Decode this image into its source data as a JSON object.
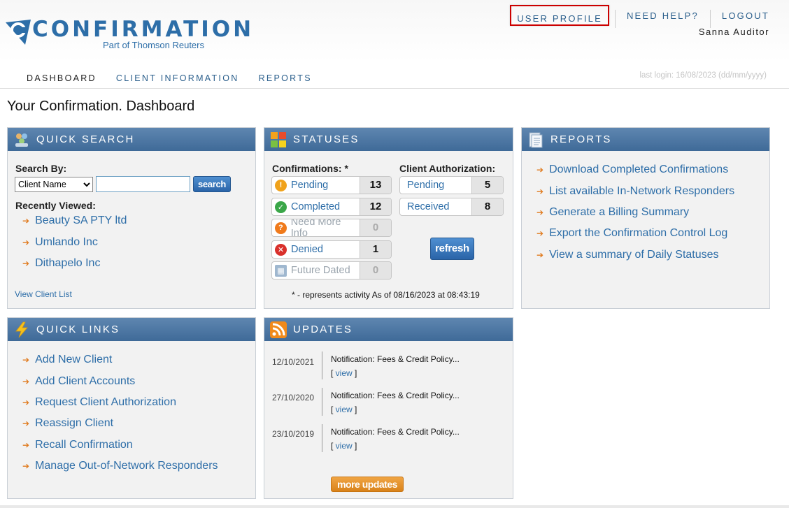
{
  "header": {
    "logo_text": "CONFIRMATION",
    "logo_sub": "Part of Thomson Reuters",
    "links": {
      "profile": "USER PROFILE",
      "help": "NEED HELP?",
      "logout": "LOGOUT"
    },
    "username": "Sanna Auditor",
    "tabs": [
      "DASHBOARD",
      "CLIENT INFORMATION",
      "REPORTS"
    ],
    "last_login": "last login: 16/08/2023 (dd/mm/yyyy)"
  },
  "page_title": "Your Confirmation. Dashboard",
  "quick_search": {
    "title": "QUICK SEARCH",
    "search_by_label": "Search By:",
    "select_value": "Client Name",
    "search_input_value": "",
    "search_button": "search",
    "recently_viewed_label": "Recently Viewed:",
    "recent": [
      "Beauty SA PTY ltd",
      "Umlando Inc",
      "Dithapelo Inc"
    ],
    "view_client_list": "View Client List"
  },
  "statuses": {
    "title": "STATUSES",
    "confirmations_label": "Confirmations: *",
    "client_auth_label": "Client Authorization:",
    "confirmations": [
      {
        "label": "Pending",
        "count": "13"
      },
      {
        "label": "Completed",
        "count": "12"
      },
      {
        "label": "Need More Info",
        "count": "0"
      },
      {
        "label": "Denied",
        "count": "1"
      },
      {
        "label": "Future Dated",
        "count": "0"
      }
    ],
    "client_authorization": [
      {
        "label": "Pending",
        "count": "5"
      },
      {
        "label": "Received",
        "count": "8"
      }
    ],
    "refresh_button": "refresh",
    "footnote": "* - represents activity As of 08/16/2023 at 08:43:19"
  },
  "reports": {
    "title": "REPORTS",
    "items": [
      "Download Completed Confirmations",
      "List available In-Network Responders",
      "Generate a Billing Summary",
      "Export the Confirmation Control Log",
      "View a summary of Daily Statuses"
    ]
  },
  "quick_links": {
    "title": "QUICK LINKS",
    "items": [
      "Add New Client",
      "Add Client Accounts",
      "Request Client Authorization",
      "Reassign Client",
      "Recall Confirmation",
      "Manage Out-of-Network Responders"
    ]
  },
  "updates": {
    "title": "UPDATES",
    "items": [
      {
        "date": "12/10/2021",
        "title": "Notification: Fees & Credit Policy...",
        "view": "view"
      },
      {
        "date": "27/10/2020",
        "title": "Notification: Fees & Credit Policy...",
        "view": "view"
      },
      {
        "date": "23/10/2019",
        "title": "Notification: Fees & Credit Policy...",
        "view": "view"
      }
    ],
    "more_button": "more updates"
  }
}
